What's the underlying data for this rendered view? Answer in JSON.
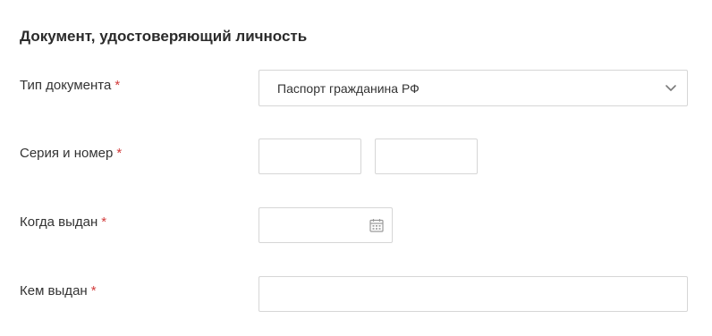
{
  "section": {
    "title": "Документ, удостоверяющий личность"
  },
  "required_marker": "*",
  "colors": {
    "required": "#d23c3c",
    "border": "#d6d6d6",
    "text": "#333333"
  },
  "fields": {
    "doc_type": {
      "label": "Тип документа",
      "value": "Паспорт гражданина РФ",
      "icon": "chevron-down-icon"
    },
    "series_number": {
      "label": "Серия и номер",
      "series_value": "",
      "number_value": ""
    },
    "issue_date": {
      "label": "Когда выдан",
      "value": "",
      "icon": "calendar-icon"
    },
    "issued_by": {
      "label": "Кем выдан",
      "value": ""
    }
  }
}
